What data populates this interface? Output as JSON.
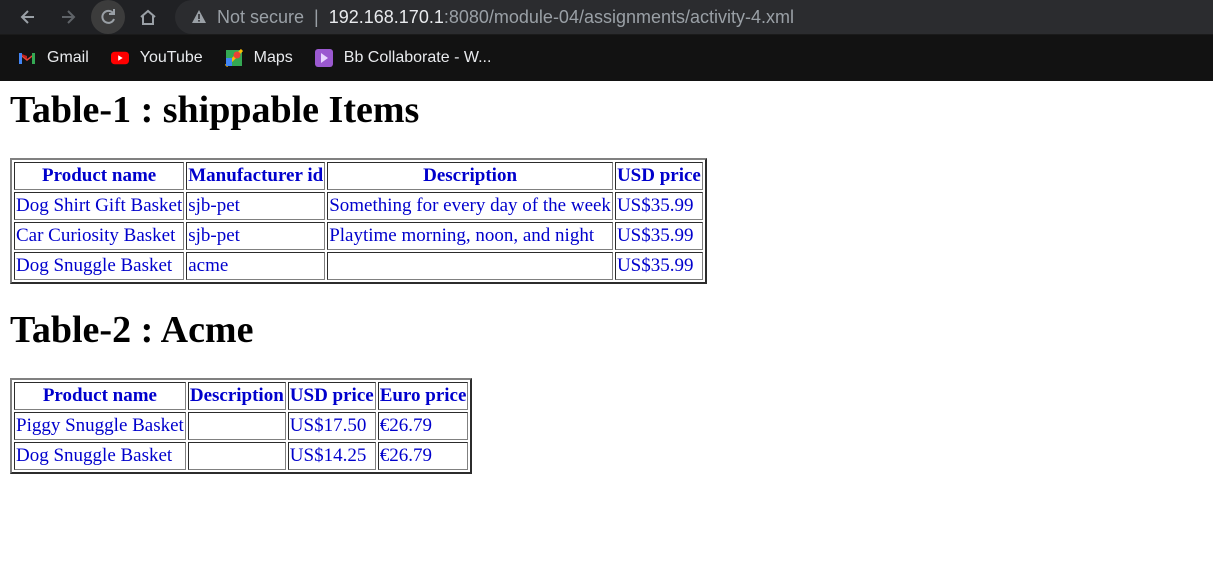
{
  "browser": {
    "security_label": "Not secure",
    "url_host": "192.168.170.1",
    "url_rest": ":8080/module-04/assignments/activity-4.xml",
    "bookmarks": [
      {
        "label": "Gmail",
        "icon": "gmail-icon"
      },
      {
        "label": "YouTube",
        "icon": "youtube-icon"
      },
      {
        "label": "Maps",
        "icon": "maps-icon"
      },
      {
        "label": "Bb Collaborate - W...",
        "icon": "collaborate-icon"
      }
    ]
  },
  "table1": {
    "title": "Table-1 : shippable Items",
    "headers": [
      "Product name",
      "Manufacturer id",
      "Description",
      "USD price"
    ],
    "rows": [
      [
        "Dog Shirt Gift Basket",
        "sjb-pet",
        "Something for every day of the week",
        "US$35.99"
      ],
      [
        "Car Curiosity Basket",
        "sjb-pet",
        "Playtime morning, noon, and night",
        "US$35.99"
      ],
      [
        "Dog Snuggle Basket",
        "acme",
        "",
        "US$35.99"
      ]
    ]
  },
  "table2": {
    "title": "Table-2 : Acme",
    "headers": [
      "Product name",
      "Description",
      "USD price",
      "Euro price"
    ],
    "rows": [
      [
        "Piggy Snuggle Basket",
        "",
        "US$17.50",
        "€26.79"
      ],
      [
        "Dog Snuggle Basket",
        "",
        "US$14.25",
        "€26.79"
      ]
    ]
  },
  "colors": {
    "table_text": "#0000cc",
    "chrome_bg": "#202124"
  }
}
